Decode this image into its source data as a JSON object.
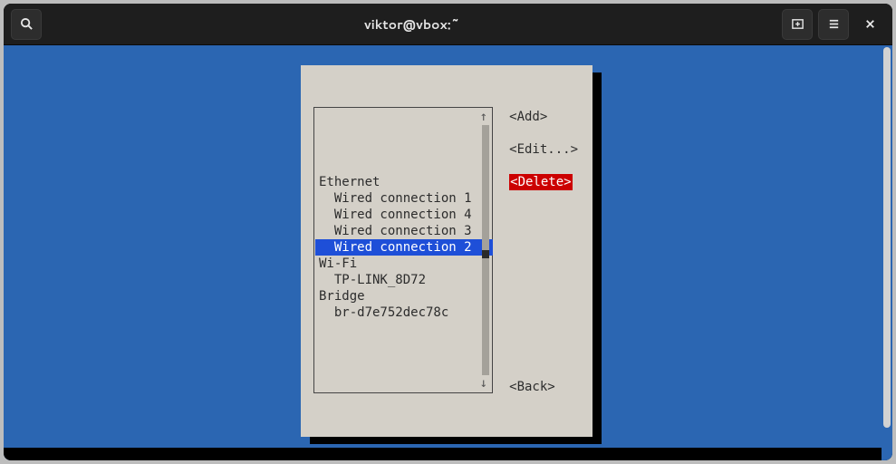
{
  "window": {
    "title": "viktor@vbox:~"
  },
  "nmtui": {
    "groups": [
      {
        "label": "Ethernet",
        "items": [
          {
            "name": "Wired connection 1",
            "selected": false
          },
          {
            "name": "Wired connection 4",
            "selected": false
          },
          {
            "name": "Wired connection 3",
            "selected": false
          },
          {
            "name": "Wired connection 2",
            "selected": true
          }
        ]
      },
      {
        "label": "Wi-Fi",
        "items": [
          {
            "name": "TP-LINK_8D72",
            "selected": false
          }
        ]
      },
      {
        "label": "Bridge",
        "items": [
          {
            "name": "br-d7e752dec78c",
            "selected": false
          }
        ]
      }
    ],
    "buttons": {
      "add": "<Add>",
      "edit": "<Edit...>",
      "delete": "<Delete>",
      "back": "<Back>"
    },
    "arrows": {
      "up": "↑",
      "down": "↓"
    }
  }
}
